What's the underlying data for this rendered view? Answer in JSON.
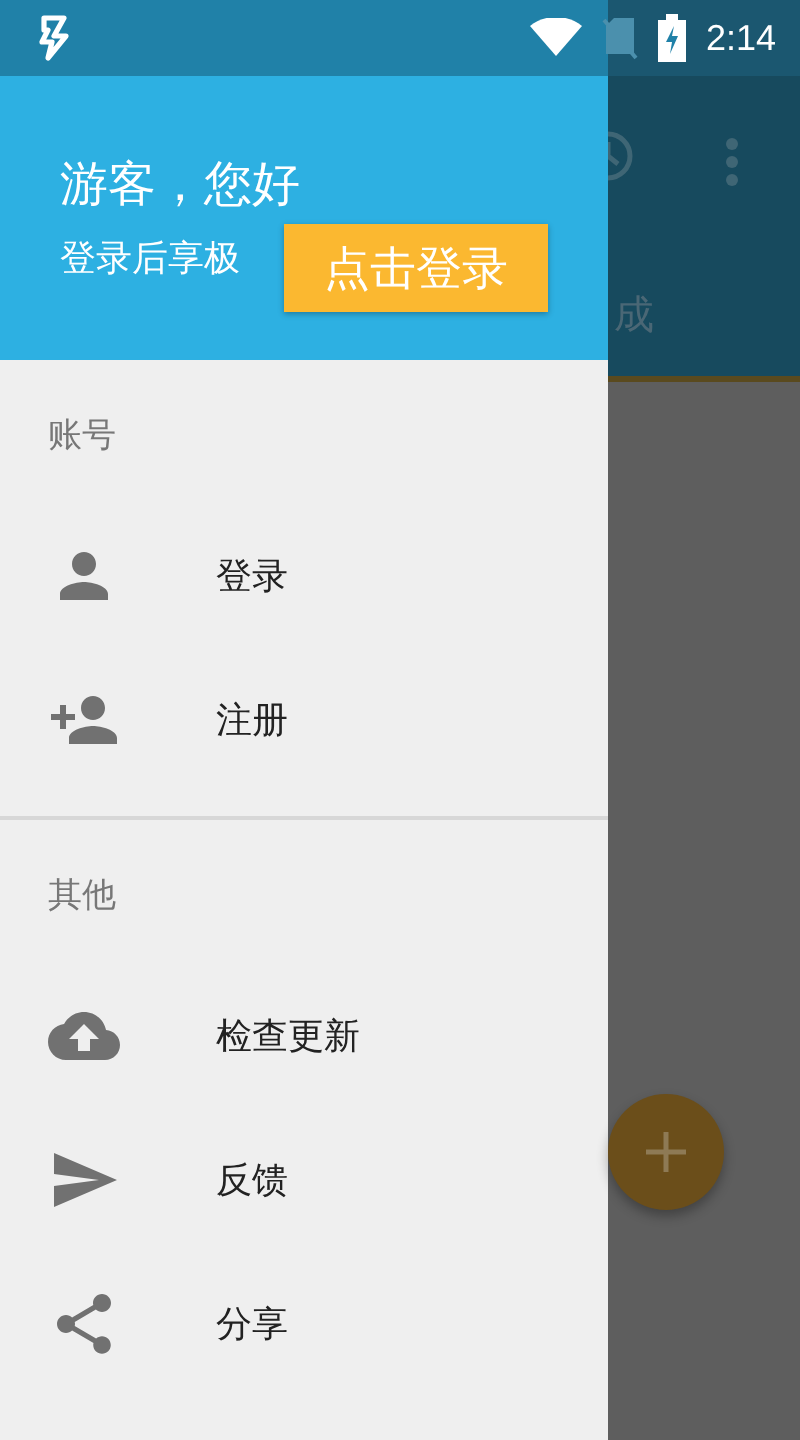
{
  "status_bar": {
    "time": "2:14"
  },
  "drawer": {
    "header": {
      "greeting": "游客，您好",
      "subtitle": "登录后享极",
      "login_button": "点击登录"
    },
    "sections": [
      {
        "title": "账号",
        "items": [
          {
            "label": "登录",
            "kind": "person"
          },
          {
            "label": "注册",
            "kind": "person-add"
          }
        ]
      },
      {
        "title": "其他",
        "items": [
          {
            "label": "检查更新",
            "kind": "cloud-upload"
          },
          {
            "label": "反馈",
            "kind": "send"
          },
          {
            "label": "分享",
            "kind": "share"
          }
        ]
      }
    ]
  },
  "background_app": {
    "tab_text": "成"
  }
}
